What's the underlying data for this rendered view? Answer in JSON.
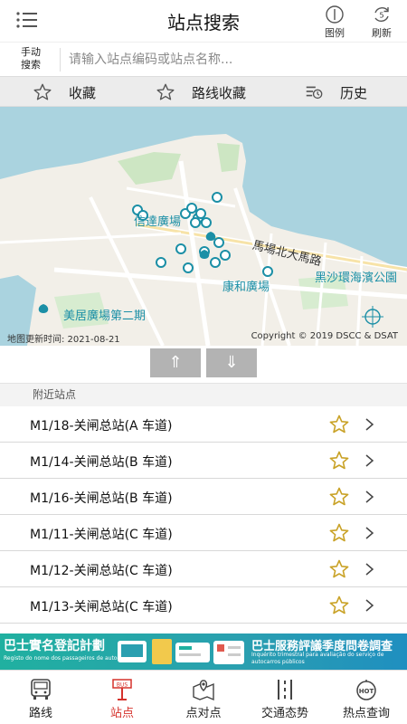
{
  "header": {
    "title": "站点搜索",
    "legend_label": "图例",
    "refresh_label": "刷新",
    "refresh_count": "5"
  },
  "search": {
    "manual_label": "手动\n搜索",
    "placeholder": "请输入站点编码或站点名称..."
  },
  "tabs": [
    {
      "label": "收藏",
      "icon": "star-outline-icon"
    },
    {
      "label": "路线收藏",
      "icon": "star-outline-icon"
    },
    {
      "label": "历史",
      "icon": "history-icon"
    }
  ],
  "map": {
    "labels": [
      "信達廣場",
      "馬場北大馬路",
      "黑沙環海濱公園",
      "康和廣場",
      "美居廣場第二期"
    ],
    "updated": "地图更新时间: 2021-08-21",
    "copyright": "Copyright © 2019 DSCC & DSAT"
  },
  "arrows": {
    "up": "⇑",
    "down": "⇓"
  },
  "nearby": {
    "header": "附近站点",
    "stops": [
      "M1/18-关闸总站(A 车道)",
      "M1/14-关闸总站(B 车道)",
      "M1/16-关闸总站(B 车道)",
      "M1/11-关闸总站(C 车道)",
      "M1/12-关闸总站(C 车道)",
      "M1/13-关闸总站(C 车道)"
    ]
  },
  "banner": {
    "left_title": "巴士實名登記計劃",
    "left_sub": "Registo do nome dos passageiros de autocarro",
    "right_title": "巴士服務評議季度問卷調查",
    "right_sub": "Inquérito trimestral para avaliação do serviço de autocarros públicos"
  },
  "bottom_nav": [
    {
      "label": "路线",
      "icon": "bus-icon"
    },
    {
      "label": "站点",
      "icon": "bus-stop-icon",
      "active": true
    },
    {
      "label": "点对点",
      "icon": "map-pin-icon"
    },
    {
      "label": "交通态势",
      "icon": "traffic-icon"
    },
    {
      "label": "热点查询",
      "icon": "hot-icon"
    }
  ],
  "colors": {
    "accent_red": "#d5322c",
    "star_gold": "#c9a227",
    "map_water": "#aad3df",
    "map_pin": "#1b8fa6"
  }
}
